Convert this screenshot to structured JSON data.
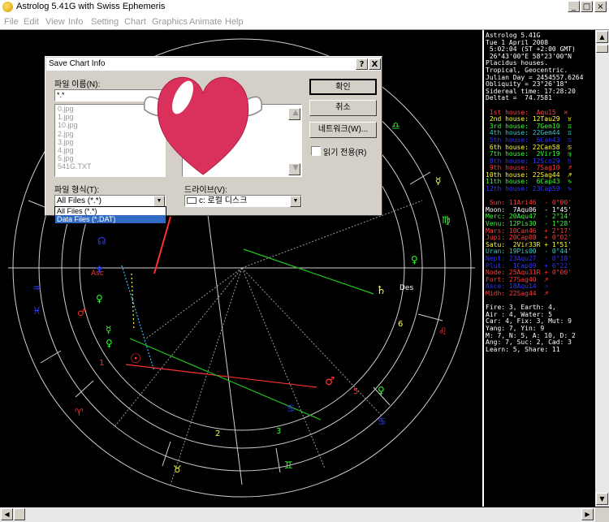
{
  "window": {
    "title": "Astrolog 5.41G with Swiss Ephemeris",
    "min_label": "_",
    "max_label": "□",
    "close_label": "×"
  },
  "menu": [
    "File",
    "Edit",
    "View",
    "Info",
    "Setting",
    "Chart",
    "Graphics",
    "Animate",
    "Help"
  ],
  "chart_labels": {
    "asc": "Asc",
    "des": "Des",
    "houses": [
      "1",
      "2",
      "3",
      "5",
      "6"
    ]
  },
  "info_panel": [
    {
      "t": "Astrolog 5.41G",
      "c": "#ffffff"
    },
    {
      "t": "Tue 1 April 2008",
      "c": "#ffffff"
    },
    {
      "t": " 5:02:04 (ST +2:00 GMT)",
      "c": "#ffffff"
    },
    {
      "t": " 26°43'00\"E 58°23'00\"N",
      "c": "#ffffff"
    },
    {
      "t": "Placidus houses.",
      "c": "#ffffff"
    },
    {
      "t": "Tropical, Geocentric.",
      "c": "#ffffff"
    },
    {
      "t": "Julian Day = 2454557.6264",
      "c": "#ffffff"
    },
    {
      "t": "Obliquity = 23°26'18\"",
      "c": "#ffffff"
    },
    {
      "t": "Sidereal time: 17:28:20",
      "c": "#ffffff"
    },
    {
      "t": "Deltat =  74.7581",
      "c": "#ffffff"
    },
    {
      "t": "",
      "c": "#ffffff"
    },
    {
      "t": " 1st house:  Aqu15  ♓",
      "c": "#ff3b3b"
    },
    {
      "t": " 2nd house: 12Tau29  ♉",
      "c": "#ffff33"
    },
    {
      "t": " 3rd house:  7Gem10  ♊",
      "c": "#33ff33"
    },
    {
      "t": " 4th house: 22Gem44  ♊",
      "c": "#33cccc"
    },
    {
      "t": " 5th house:  6Can43  ♋",
      "c": "#3333ff"
    },
    {
      "t": " 6th house: 22Can58  ♋",
      "c": "#ffff33"
    },
    {
      "t": " 7th house:  2Vir19  ♍",
      "c": "#33ff33"
    },
    {
      "t": " 8th house: 12Sco29  ♏",
      "c": "#3333ff"
    },
    {
      "t": " 9th house:  7Sag10  ♐",
      "c": "#ff3b3b"
    },
    {
      "t": "10th house: 22Sag44  ♐",
      "c": "#ffff33"
    },
    {
      "t": "11th house:  6Cap43  ♑",
      "c": "#33ff33"
    },
    {
      "t": "12th house: 23Cap59  ♑",
      "c": "#3333ff"
    },
    {
      "t": "",
      "c": "#ffffff"
    },
    {
      "t": " Sun: 11Ari46  - 0°00'",
      "c": "#ff3b3b"
    },
    {
      "t": "Moon:  7Aqu06  - 1°45'",
      "c": "#ffffff"
    },
    {
      "t": "Merc: 20Aqu47  - 2°14'",
      "c": "#33ff33"
    },
    {
      "t": "Venu: 12Pis30  - 1°28'",
      "c": "#33ff33"
    },
    {
      "t": "Mars: 10Can46  + 2°17'",
      "c": "#ff3b3b"
    },
    {
      "t": "Jupi: 20Cap08  + 0°02'",
      "c": "#ff3b3b"
    },
    {
      "t": "Satu:  2Vir33R + 1°51'",
      "c": "#ffff33"
    },
    {
      "t": "Uran: 19Pis00  - 0°44'",
      "c": "#33cccc"
    },
    {
      "t": "Nept: 23Aqu27  - 0°18'",
      "c": "#3333ff"
    },
    {
      "t": "Plut:  1Cap09  + 6°22'",
      "c": "#3333ff"
    },
    {
      "t": "Node: 25Aqu31R + 0°00'",
      "c": "#ff3b3b"
    },
    {
      "t": "Fort: 27Sag40  ♐",
      "c": "#ff3b3b"
    },
    {
      "t": "Asce: 18Aqu14  ♒",
      "c": "#3333ff"
    },
    {
      "t": "Midh: 22Sag44  ♐",
      "c": "#ff3b3b"
    },
    {
      "t": "",
      "c": "#ffffff"
    },
    {
      "t": "Fire: 3, Earth: 4,",
      "c": "#ffffff"
    },
    {
      "t": "Air : 4, Water: 5",
      "c": "#ffffff"
    },
    {
      "t": "Car: 4, Fix: 3, Mut: 9",
      "c": "#ffffff"
    },
    {
      "t": "Yang: 7, Yin: 9",
      "c": "#ffffff"
    },
    {
      "t": "M: 7, N: 5, A: 10, D: 2",
      "c": "#ffffff"
    },
    {
      "t": "Ang: 7, Suc: 2, Cad: 3",
      "c": "#ffffff"
    },
    {
      "t": "Learn: 5, Share: 11",
      "c": "#ffffff"
    }
  ],
  "dialog": {
    "title": "Save Chart Info",
    "help_label": "?",
    "close_label": "X",
    "filename_label": "파일 이름(N):",
    "filename_value": "*.*",
    "file_list": [
      "0.jpg",
      "1.jpg",
      "10.jpg",
      "2.jpg",
      "3.jpg",
      "4.jpg",
      "5.jpg",
      "541G.TXT"
    ],
    "type_label": "파일 형식(T):",
    "type_value": "All Files (*.*)",
    "type_options": [
      "All Files (*.*)",
      "Data Files (*.DAT)"
    ],
    "drive_label": "드라이브(V):",
    "drive_value": "c: 로컬 디스크",
    "ok_label": "확인",
    "cancel_label": "취소",
    "network_label": "네트워크(W)...",
    "readonly_label": "읽기 전용(R)"
  }
}
